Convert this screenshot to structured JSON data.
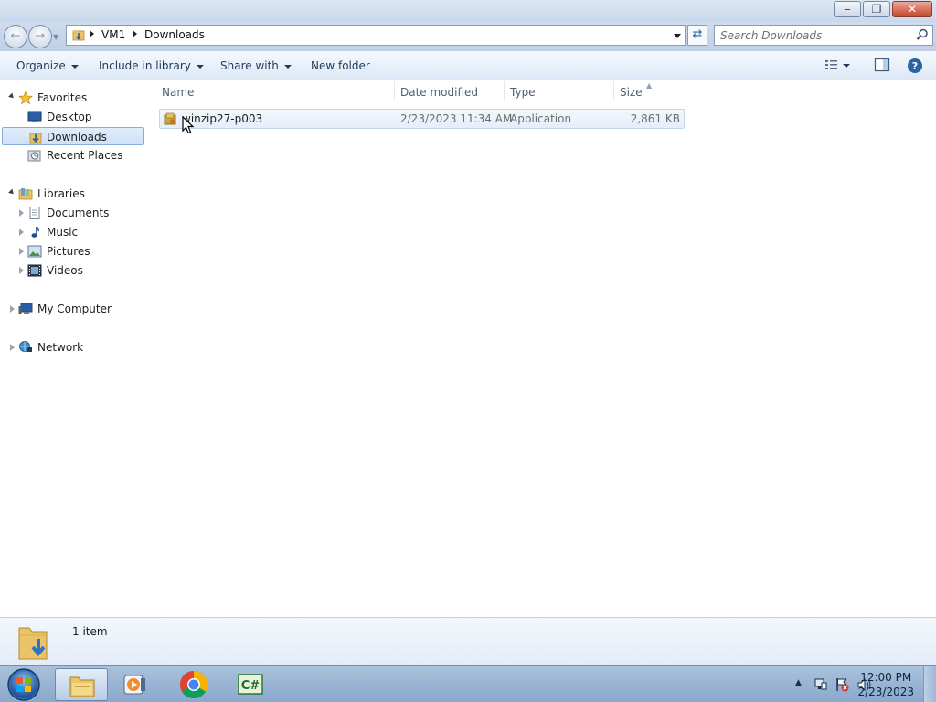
{
  "window": {
    "controls": [
      "minimize-icon",
      "restore-icon",
      "close-icon"
    ]
  },
  "address": {
    "crumbs": [
      "VM1",
      "Downloads"
    ],
    "search_placeholder": "Search Downloads"
  },
  "toolbar": {
    "organize": "Organize",
    "include_in_library": "Include in library",
    "share_with": "Share with",
    "new_folder": "New folder"
  },
  "nav": {
    "favorites": {
      "label": "Favorites",
      "items": [
        {
          "label": "Desktop",
          "icon": "desktop-icon"
        },
        {
          "label": "Downloads",
          "icon": "downloads-folder-icon",
          "selected": true
        },
        {
          "label": "Recent Places",
          "icon": "recent-places-icon"
        }
      ]
    },
    "libraries": {
      "label": "Libraries",
      "items": [
        {
          "label": "Documents",
          "icon": "documents-icon"
        },
        {
          "label": "Music",
          "icon": "music-icon"
        },
        {
          "label": "Pictures",
          "icon": "pictures-icon"
        },
        {
          "label": "Videos",
          "icon": "videos-icon"
        }
      ]
    },
    "computer": "My Computer",
    "network": "Network"
  },
  "columns": {
    "name": "Name",
    "date_modified": "Date modified",
    "type": "Type",
    "size": "Size"
  },
  "files": [
    {
      "name": "winzip27-p003",
      "date_modified": "2/23/2023 11:34 AM",
      "type": "Application",
      "size": "2,861 KB"
    }
  ],
  "details": {
    "item_count": "1 item"
  },
  "taskbar": {
    "apps": [
      "windows-explorer-icon",
      "media-player-icon",
      "chrome-icon",
      "csharp-app-icon"
    ]
  },
  "clock": {
    "time": "12:00 PM",
    "date": "2/23/2023"
  },
  "colors": {
    "accent": "#2c62a6",
    "selection": "#cfe1f7",
    "taskbar": "#8aa8cb"
  }
}
